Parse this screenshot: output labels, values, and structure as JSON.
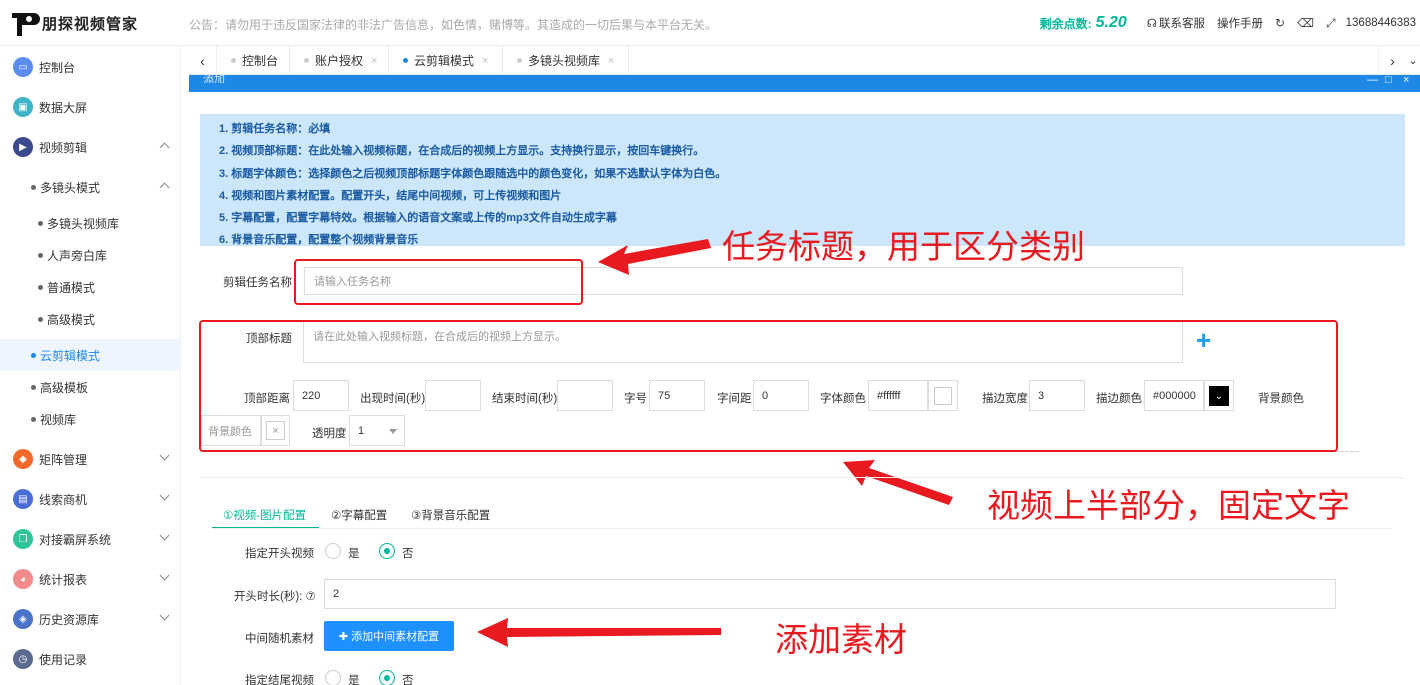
{
  "header": {
    "logo_text": "朋探视频管家",
    "notice": "公告：请勿用于违反国家法律的非法广告信息，如色情，赌博等。其造成的一切后果与本平台无关。",
    "points_label": "剩余点数:",
    "points_value": "5.20",
    "contact": "联系客服",
    "manual": "操作手册",
    "phone": "13688446383"
  },
  "sidebar": {
    "items": [
      {
        "label": "控制台",
        "icon": "monitor-icon",
        "color": "#5b8def"
      },
      {
        "label": "数据大屏",
        "icon": "screen-icon",
        "color": "#3fb3c8"
      },
      {
        "label": "视频剪辑",
        "icon": "video-edit-icon",
        "color": "#3b4a8f"
      },
      {
        "label": "多镜头模式"
      },
      {
        "label": "多镜头视频库"
      },
      {
        "label": "人声旁白库"
      },
      {
        "label": "普通模式"
      },
      {
        "label": "高级模式"
      },
      {
        "label": "云剪辑模式"
      },
      {
        "label": "高级模板"
      },
      {
        "label": "视频库"
      },
      {
        "label": "矩阵管理",
        "icon": "matrix-icon",
        "color": "#f26b2c"
      },
      {
        "label": "线索商机",
        "icon": "chart-icon",
        "color": "#4a6ed8"
      },
      {
        "label": "对接霸屏系统",
        "icon": "copy-icon",
        "color": "#2fc59a"
      },
      {
        "label": "统计报表",
        "icon": "pie-icon",
        "color": "#f28b8b"
      },
      {
        "label": "历史资源库",
        "icon": "layers-icon",
        "color": "#4a74c9"
      },
      {
        "label": "使用记录",
        "icon": "clock-icon",
        "color": "#5b6a8f"
      }
    ]
  },
  "tabs": [
    {
      "label": "控制台"
    },
    {
      "label": "账户授权"
    },
    {
      "label": "云剪辑模式"
    },
    {
      "label": "多镜头视频库"
    }
  ],
  "modal": {
    "title": "添加"
  },
  "info": [
    "1. 剪辑任务名称：必填",
    "2. 视频顶部标题：在此处输入视频标题，在合成后的视频上方显示。支持换行显示，按回车键换行。",
    "3. 标题字体颜色：选择颜色之后视频顶部标题字体颜色跟随选中的颜色变化，如果不选默认字体为白色。",
    "4. 视频和图片素材配置。配置开头，结尾中间视频，可上传视频和图片",
    "5. 字幕配置，配置字幕特效。根据输入的语音文案或上传的mp3文件自动生成字幕",
    "6. 背景音乐配置，配置整个视频背景音乐"
  ],
  "form": {
    "task_name_label": "剪辑任务名称",
    "task_name_placeholder": "请输入任务名称",
    "top_title_label": "顶部标题",
    "top_title_placeholder": "请在此处输入视频标题，在合成后的视频上方显示。",
    "top_distance_label": "顶部距离",
    "top_distance": "220",
    "show_time_label": "出现时间(秒)",
    "end_time_label": "结束时间(秒)",
    "font_size_label": "字号",
    "font_size": "75",
    "spacing_label": "字间距",
    "spacing": "0",
    "font_color_label": "字体颜色",
    "font_color": "#ffffff",
    "stroke_width_label": "描边宽度",
    "stroke_width": "3",
    "stroke_color_label": "描边颜色",
    "stroke_color": "#000000",
    "bg_color_label": "背景颜色",
    "bg_color_placeholder": "背景颜色",
    "opacity_label": "透明度",
    "opacity": "1"
  },
  "config_tabs": [
    "①视频-图片配置",
    "②字幕配置",
    "③背景音乐配置"
  ],
  "config": {
    "start_video_label": "指定开头视频",
    "yes": "是",
    "no": "否",
    "start_duration_label": "开头时长(秒): ⑦",
    "start_duration": "2",
    "middle_label": "中间随机素材",
    "add_button": "✚ 添加中间素材配置",
    "end_video_label": "指定结尾视频"
  },
  "annotations": {
    "a1": "任务标题，用于区分类别",
    "a2": "视频上半部分，固定文字",
    "a3": "添加素材"
  },
  "colors": {
    "accent": "#1e88e5",
    "green": "#00b899",
    "red": "#e8191f"
  }
}
